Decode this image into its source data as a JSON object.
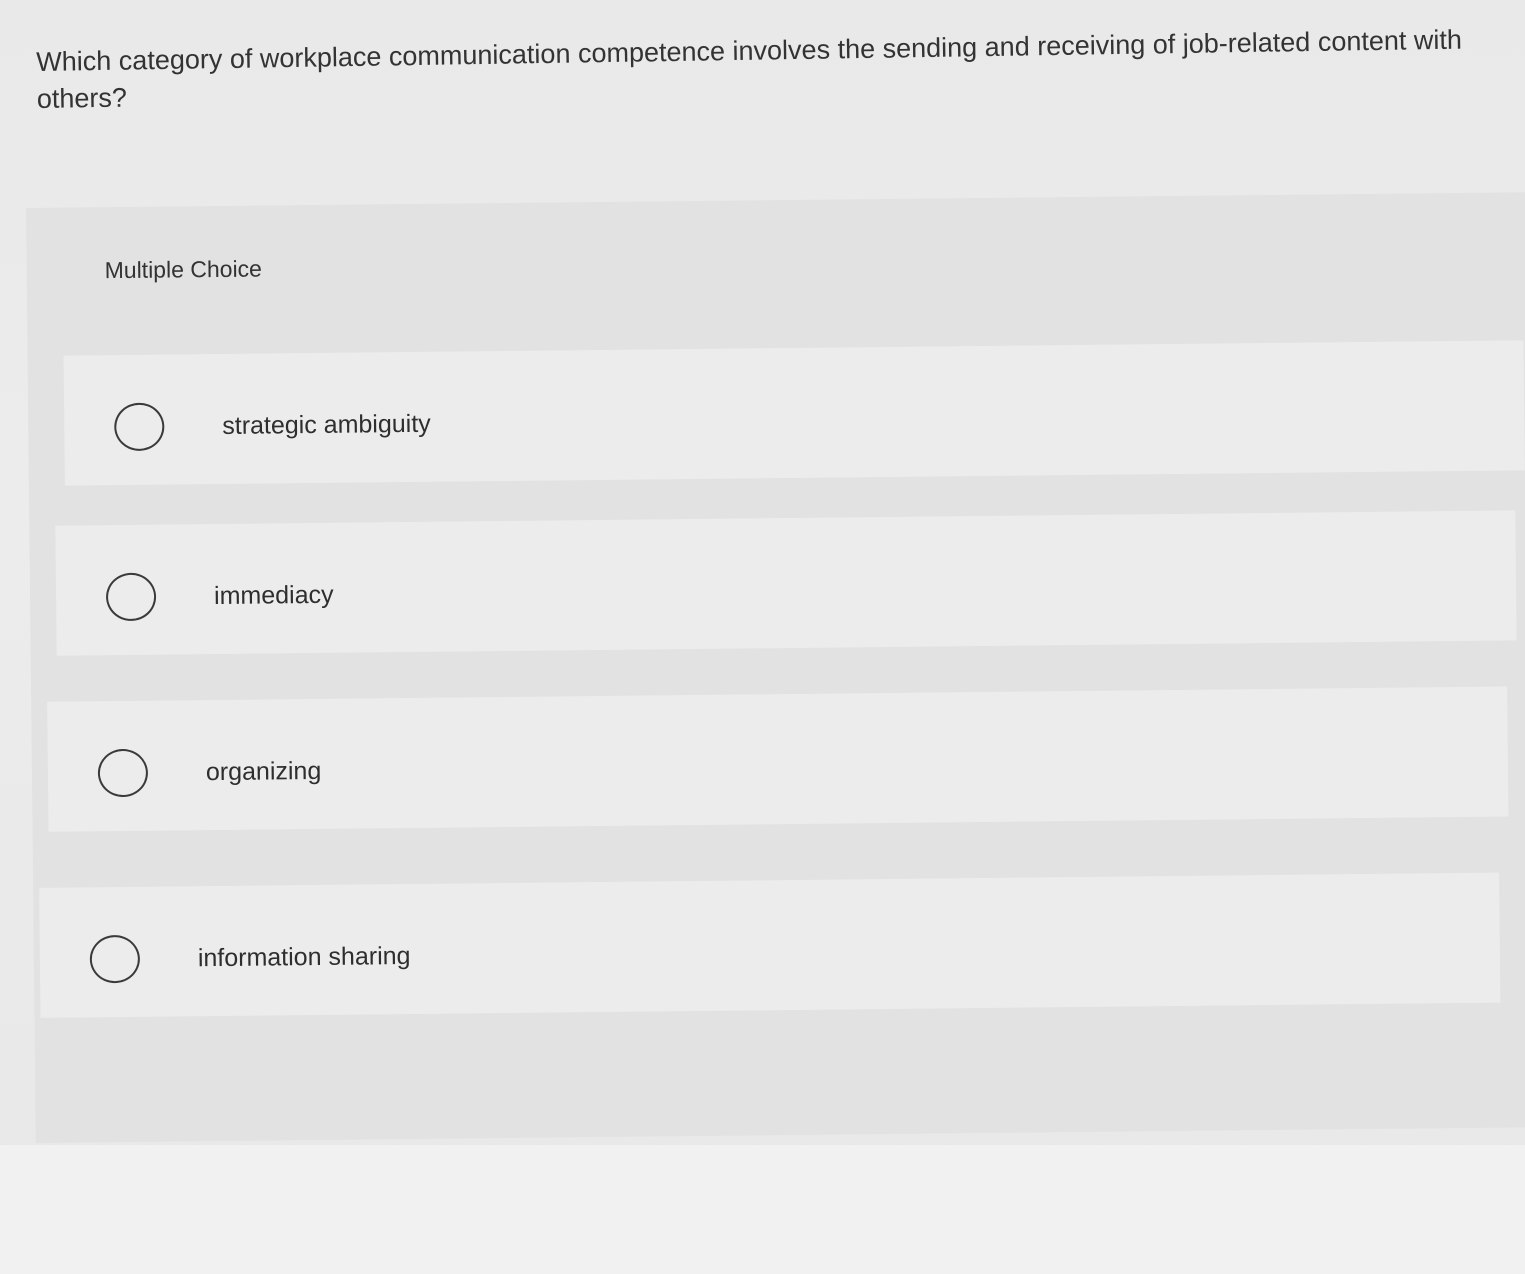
{
  "question": {
    "text": "Which category of workplace communication competence involves the sending and receiving of job-related content with others?"
  },
  "choice_block": {
    "heading": "Multiple Choice",
    "options": [
      {
        "label": "strategic ambiguity",
        "selected": false
      },
      {
        "label": "immediacy",
        "selected": false
      },
      {
        "label": "organizing",
        "selected": false
      },
      {
        "label": "information sharing",
        "selected": false
      }
    ]
  }
}
